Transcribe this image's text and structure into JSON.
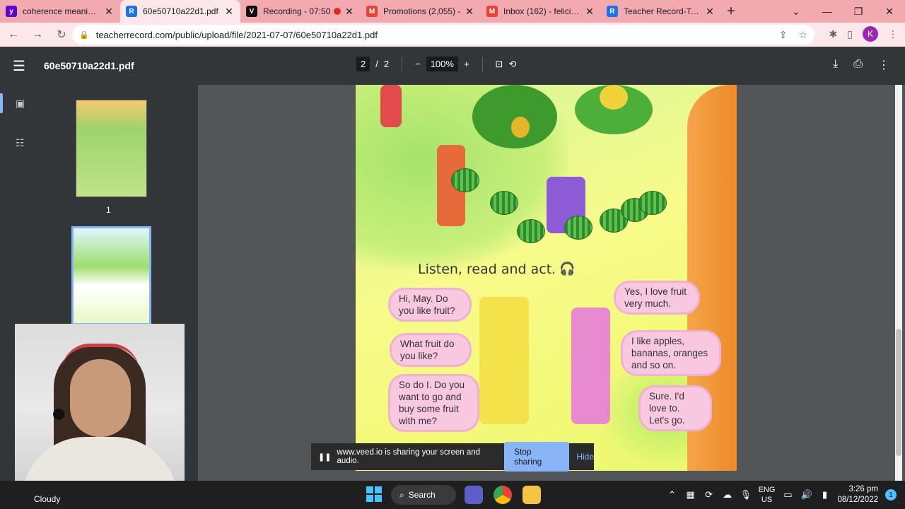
{
  "tabs": [
    {
      "title": "coherence meaning -",
      "favicon": "yahoo-icon",
      "color": "#6001d2"
    },
    {
      "title": "60e50710a22d1.pdf",
      "favicon": "teacher-record-icon",
      "color": "#1a73e8",
      "active": true
    },
    {
      "title": "Recording - 07:50",
      "favicon": "veed-icon",
      "color": "#111111",
      "recording": true
    },
    {
      "title": "Promotions (2,055) -",
      "favicon": "gmail-icon",
      "color": "#ea4335"
    },
    {
      "title": "Inbox (162) - feliciano",
      "favicon": "gmail-icon",
      "color": "#ea4335"
    },
    {
      "title": "Teacher Record-Teach",
      "favicon": "teacher-record-icon",
      "color": "#1a73e8"
    }
  ],
  "address": {
    "url": "teacherrecord.com/public/upload/file/2021-07-07/60e50710a22d1.pdf",
    "profile_initial": "K"
  },
  "pdf": {
    "filename": "60e50710a22d1.pdf",
    "current_page": "2",
    "separator": "/",
    "total_pages": "2",
    "zoom": "100%",
    "thumbnail_labels": [
      "1"
    ]
  },
  "page_content": {
    "heading": "Listen, read and act.",
    "bubbles_left": [
      "Hi, May. Do you like fruit?",
      "What fruit do you like?",
      "So do I. Do you want to go and buy some fruit with me?"
    ],
    "bubbles_right": [
      "Yes, I love fruit very much.",
      "I like apples, bananas, oranges and so on.",
      "Sure. I'd love to. Let's go."
    ]
  },
  "share_bar": {
    "message": "www.veed.io is sharing your screen and audio.",
    "stop_label": "Stop sharing",
    "hide_label": "Hide"
  },
  "taskbar": {
    "weather": "Cloudy",
    "search_label": "Search",
    "language_top": "ENG",
    "language_bottom": "US",
    "time": "3:26 pm",
    "date": "08/12/2022",
    "notification_count": "1"
  },
  "colors": {
    "tab_strip": "#f3a9b0",
    "active_tab": "#fce8ea",
    "pdf_toolbar": "#323639",
    "viewer_bg": "#525659",
    "accent": "#8ab4f8"
  }
}
